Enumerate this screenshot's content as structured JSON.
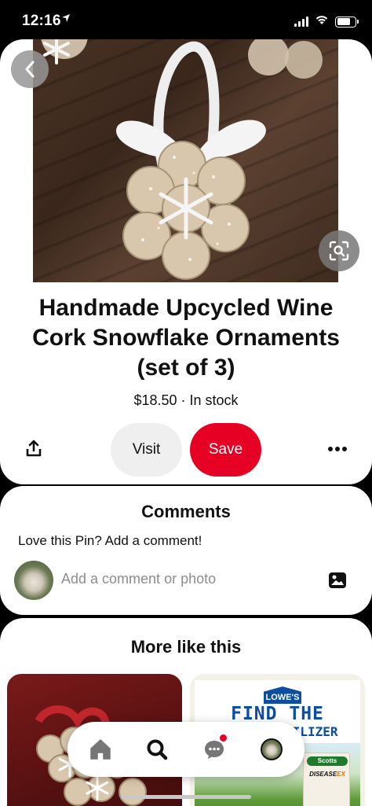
{
  "status_bar": {
    "time": "12:16",
    "location_icon": "location-arrow-icon",
    "signal_icon": "cellular-signal-icon",
    "wifi_icon": "wifi-icon",
    "battery_icon": "battery-icon",
    "battery_level": 0.75
  },
  "pin": {
    "image_icon": "wine-cork-snowflake-ornament-photo",
    "title": "Handmade Upcycled Wine Cork Snowflake Ornaments (set of 3)",
    "price": "$18.50",
    "separator": "·",
    "availability": "In stock",
    "actions": {
      "visit_label": "Visit",
      "save_label": "Save",
      "share_icon": "share-icon",
      "more_icon": "more-options-icon"
    },
    "back_icon": "chevron-left-icon",
    "lens_icon": "visual-search-icon"
  },
  "comments": {
    "title": "Comments",
    "prompt": "Love this Pin? Add a comment!",
    "input_placeholder": "Add a comment or photo",
    "photo_icon": "image-icon"
  },
  "more_like_this": {
    "title": "More like this",
    "tiles": [
      {
        "icon": "cork-ornament-photo"
      },
      {
        "icon": "lowes-ad-photo",
        "brand": "LOWE'S",
        "headline_line1": "FIND THE",
        "headline_line2": "RIGHT FERTILIZER",
        "product_brand": "Scotts",
        "product_name_part1": "DISEASE",
        "product_name_part2": "EX"
      }
    ]
  },
  "bottom_nav": {
    "items": [
      {
        "icon": "home-icon"
      },
      {
        "icon": "search-icon"
      },
      {
        "icon": "messages-icon",
        "has_notification": true
      },
      {
        "icon": "profile-avatar-icon"
      }
    ],
    "colors": {
      "active": "#111111",
      "inactive": "#767676",
      "notification": "#e60023"
    }
  },
  "colors": {
    "save_red": "#e60023",
    "visit_gray": "#efefef",
    "background": "#000000"
  }
}
